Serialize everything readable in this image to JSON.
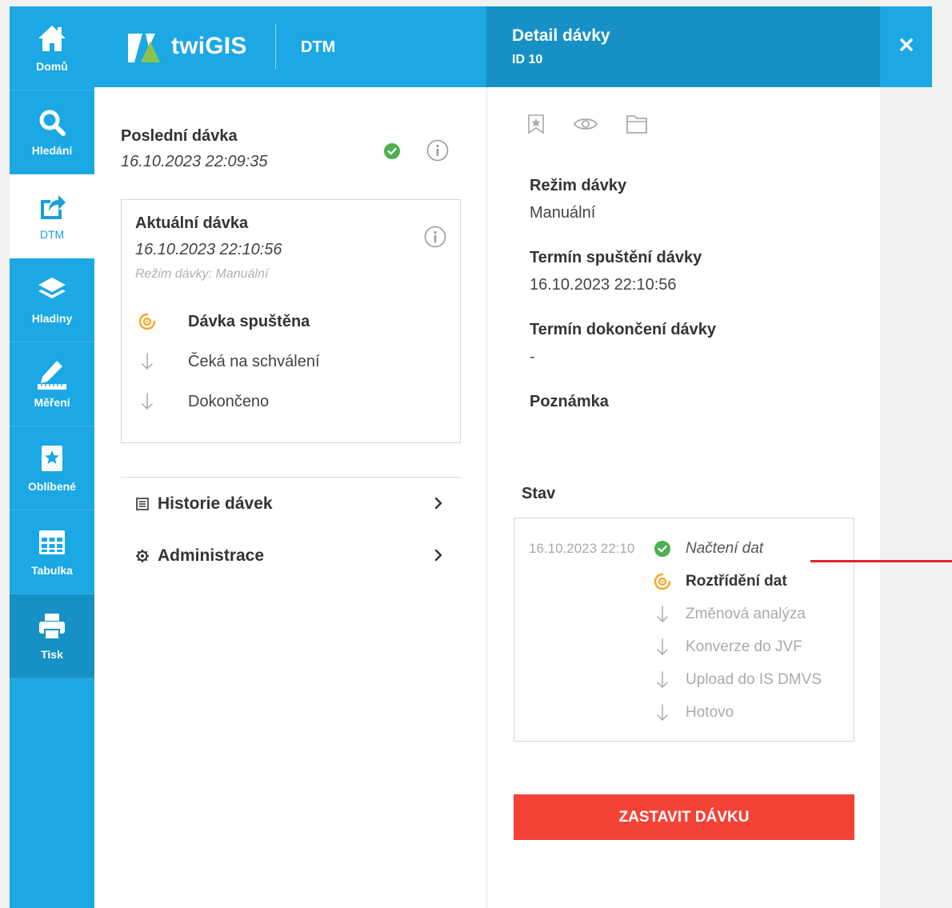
{
  "nav": {
    "items": [
      {
        "label": "Domů",
        "icon": "home-icon"
      },
      {
        "label": "Hledání",
        "icon": "search-icon"
      },
      {
        "label": "DTM",
        "icon": "share-icon",
        "active": true
      },
      {
        "label": "Hladiny",
        "icon": "layers-icon"
      },
      {
        "label": "Měření",
        "icon": "ruler-pencil-icon"
      },
      {
        "label": "Oblíbené",
        "icon": "bookmark-star-icon"
      },
      {
        "label": "Tabulka",
        "icon": "table-icon"
      },
      {
        "label": "Tisk",
        "icon": "printer-icon"
      }
    ]
  },
  "header": {
    "logo_text": "twiGIS",
    "module": "DTM"
  },
  "detail_header": {
    "title": "Detail dávky",
    "id": "ID 10"
  },
  "last_batch": {
    "title": "Poslední dávka",
    "date": "16.10.2023 22:09:35"
  },
  "current_batch": {
    "title": "Aktuální dávka",
    "date": "16.10.2023 22:10:56",
    "mode": "Režim dávky: Manuální",
    "steps": [
      {
        "label": "Dávka spuštěna",
        "state": "active"
      },
      {
        "label": "Čeká na schválení",
        "state": "pending"
      },
      {
        "label": "Dokončeno",
        "state": "pending"
      }
    ]
  },
  "menu": {
    "history": "Historie dávek",
    "admin": "Administrace"
  },
  "detail": {
    "mode_label": "Režim dávky",
    "mode_value": "Manuální",
    "start_label": "Termín spuštění dávky",
    "start_value": "16.10.2023 22:10:56",
    "end_label": "Termín dokončení dávky",
    "end_value": "-",
    "note_label": "Poznámka",
    "status_label": "Stav",
    "status_date": "16.10.2023 22:10",
    "status_steps": [
      {
        "label": "Načtení dat",
        "state": "done"
      },
      {
        "label": "Roztřídění dat",
        "state": "active"
      },
      {
        "label": "Změnová analýza",
        "state": "pending"
      },
      {
        "label": "Konverze do JVF",
        "state": "pending"
      },
      {
        "label": "Upload do IS DMVS",
        "state": "pending"
      },
      {
        "label": "Hotovo",
        "state": "pending"
      }
    ],
    "stop_button": "ZASTAVIT DÁVKU"
  },
  "colors": {
    "primary": "#1ba8e4",
    "primary_dark": "#1790c5",
    "ok": "#4caf50",
    "active_step": "#f5a623",
    "danger": "#f44336"
  }
}
